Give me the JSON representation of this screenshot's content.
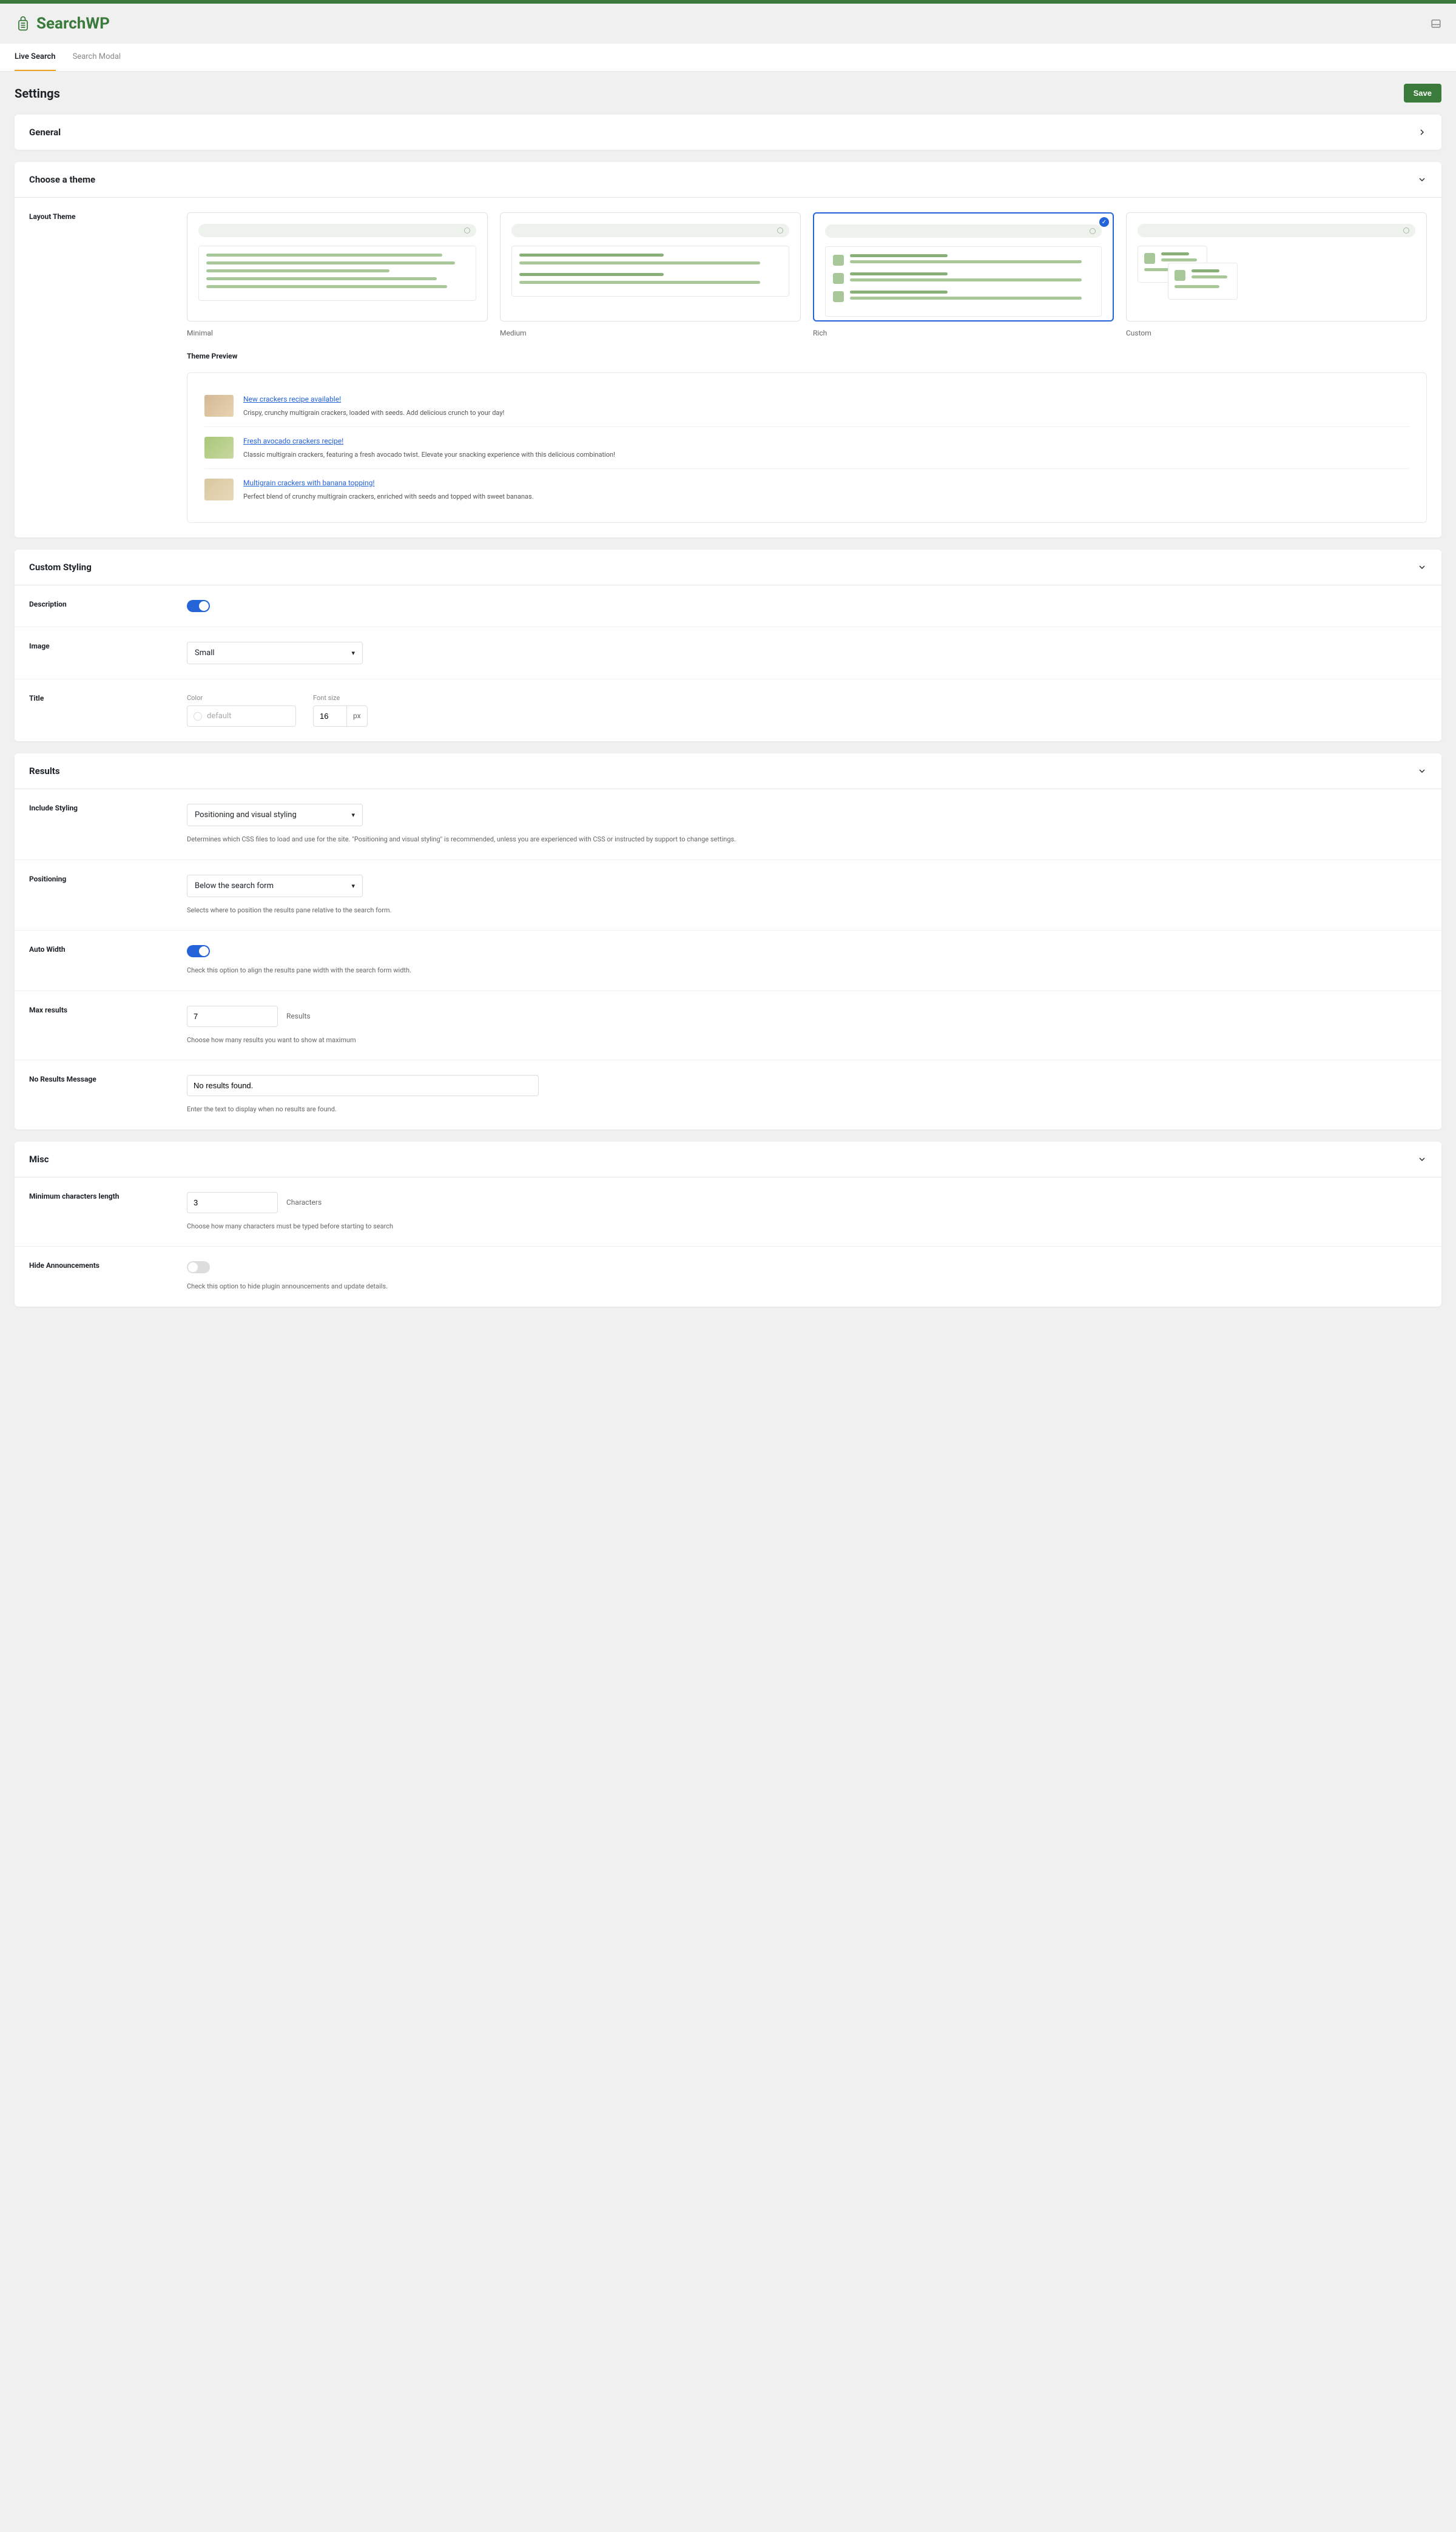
{
  "brand": "SearchWP",
  "tabs": {
    "live": "Live Search",
    "modal": "Search Modal"
  },
  "page_title": "Settings",
  "save_label": "Save",
  "panels": {
    "general": "General",
    "theme": "Choose a theme",
    "custom": "Custom Styling",
    "results": "Results",
    "misc": "Misc"
  },
  "theme": {
    "layout_label": "Layout Theme",
    "preview_label": "Theme Preview",
    "options": {
      "minimal": "Minimal",
      "medium": "Medium",
      "rich": "Rich",
      "custom": "Custom"
    },
    "preview": [
      {
        "title": "New crackers recipe available!",
        "desc": "Crispy, crunchy multigrain crackers, loaded with seeds. Add delicious crunch to your day!"
      },
      {
        "title": "Fresh avocado crackers recipe!",
        "desc": "Classic multigrain crackers, featuring a fresh avocado twist. Elevate your snacking experience with this delicious combination!"
      },
      {
        "title": "Multigrain crackers with banana topping!",
        "desc": "Perfect blend of crunchy multigrain crackers, enriched with seeds and topped with sweet bananas."
      }
    ]
  },
  "custom": {
    "description_label": "Description",
    "image_label": "Image",
    "image_value": "Small",
    "title_label": "Title",
    "color_label": "Color",
    "color_placeholder": "default",
    "fontsize_label": "Font size",
    "fontsize_value": "16",
    "fontsize_unit": "px"
  },
  "results": {
    "include_label": "Include Styling",
    "include_value": "Positioning and visual styling",
    "include_help": "Determines which CSS files to load and use for the site. \"Positioning and visual styling\" is recommended, unless you are experienced with CSS or instructed by support to change settings.",
    "positioning_label": "Positioning",
    "positioning_value": "Below the search form",
    "positioning_help": "Selects where to position the results pane relative to the search form.",
    "autowidth_label": "Auto Width",
    "autowidth_help": "Check this option to align the results pane width with the search form width.",
    "max_label": "Max results",
    "max_value": "7",
    "max_suffix": "Results",
    "max_help": "Choose how many results you want to show at maximum",
    "noresults_label": "No Results Message",
    "noresults_value": "No results found.",
    "noresults_help": "Enter the text to display when no results are found."
  },
  "misc": {
    "minchars_label": "Minimum characters length",
    "minchars_value": "3",
    "minchars_suffix": "Characters",
    "minchars_help": "Choose how many characters must be typed before starting to search",
    "hide_label": "Hide Announcements",
    "hide_help": "Check this option to hide plugin announcements and update details."
  }
}
